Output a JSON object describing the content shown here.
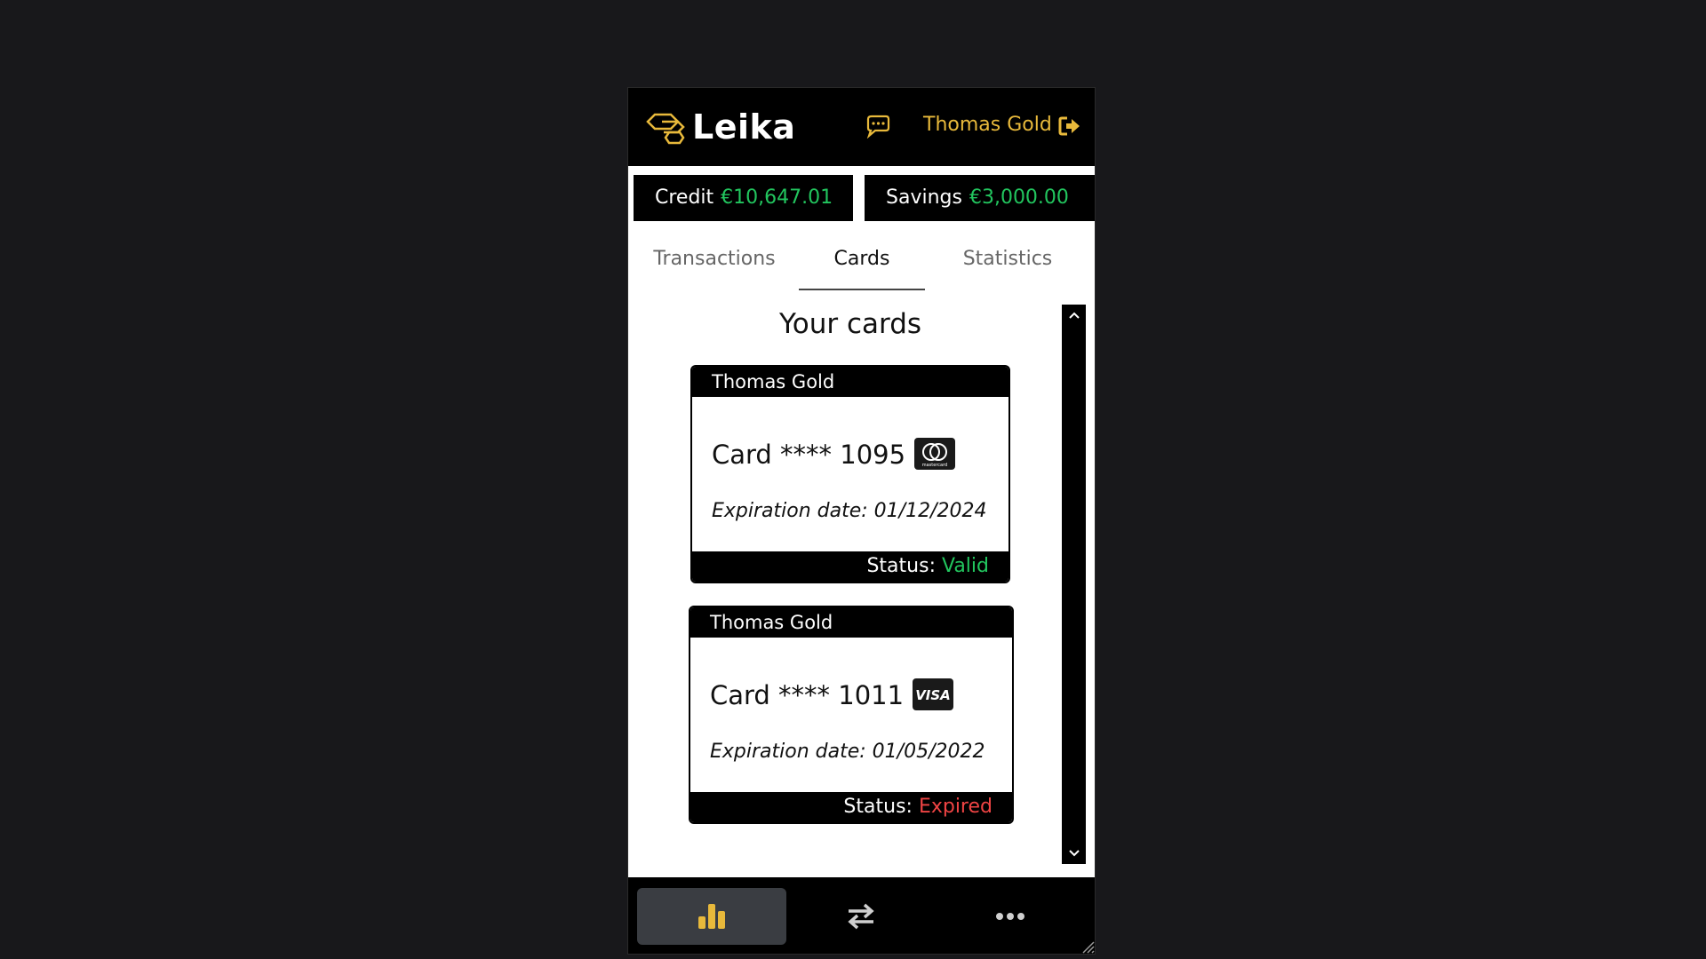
{
  "app": {
    "name": "Leika"
  },
  "header": {
    "user_name": "Thomas Gold"
  },
  "balances": [
    {
      "label": "Credit",
      "amount": "€10,647.01"
    },
    {
      "label": "Savings",
      "amount": "€3,000.00"
    }
  ],
  "tabs": [
    {
      "label": "Transactions",
      "active": false
    },
    {
      "label": "Cards",
      "active": true
    },
    {
      "label": "Statistics",
      "active": false
    }
  ],
  "cards_section": {
    "title": "Your cards",
    "cards": [
      {
        "holder": "Thomas Gold",
        "number": "Card **** 1095",
        "brand": "mastercard",
        "expiration": "Expiration date: 01/12/2024",
        "status_label": "Status:",
        "status": "Valid"
      },
      {
        "holder": "Thomas Gold",
        "number": "Card **** 1011",
        "brand": "VISA",
        "expiration": "Expiration date: 01/05/2022",
        "status_label": "Status:",
        "status": "Expired"
      }
    ]
  },
  "bottom_nav": [
    {
      "icon": "bar-chart-icon",
      "active": true
    },
    {
      "icon": "transfer-arrows-icon",
      "active": false
    },
    {
      "icon": "more-dots-icon",
      "active": false
    }
  ],
  "colors": {
    "accent": "#e8b93b",
    "positive": "#22c55e",
    "negative": "#ef4444",
    "background": "#18181b",
    "panel": "#000000"
  }
}
